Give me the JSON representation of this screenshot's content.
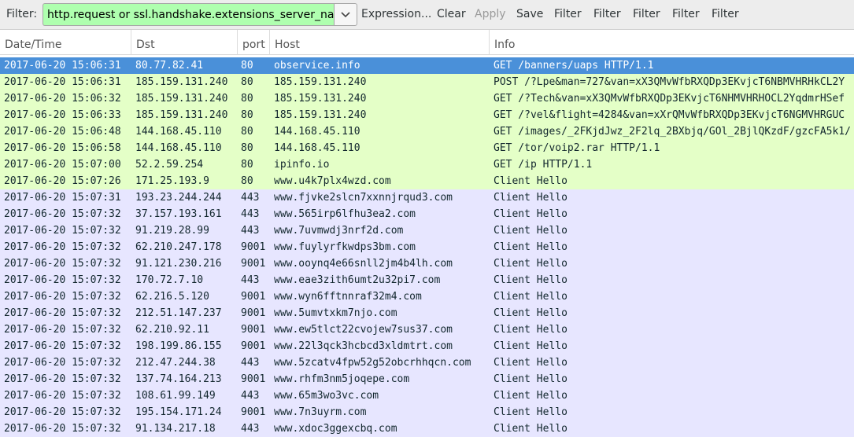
{
  "toolbar": {
    "filter_label": "Filter:",
    "filter_value": "http.request or ssl.handshake.extensions_server_name",
    "dropdown_icon": "chevron-down-icon",
    "buttons": [
      "Expression...",
      "Clear",
      "Apply",
      "Save",
      "Filter",
      "Filter",
      "Filter",
      "Filter",
      "Filter"
    ],
    "disabled": [
      "Apply"
    ]
  },
  "columns": [
    "Date/Time",
    "Dst",
    "port",
    "Host",
    "Info"
  ],
  "colors": {
    "selected": "#4a90d9",
    "http_row": "#e4ffc7",
    "tls_row": "#e7e6ff",
    "filter_valid": "#afffaf"
  },
  "rows": [
    {
      "date": "2017-06-20 15:06:31",
      "dst": "80.77.82.41",
      "port": "80",
      "host": "observice.info",
      "info": "GET /banners/uaps HTTP/1.1",
      "type": "http",
      "selected": true
    },
    {
      "date": "2017-06-20 15:06:31",
      "dst": "185.159.131.240",
      "port": "80",
      "host": "185.159.131.240",
      "info": "POST /?Lpe&man=727&van=xX3QMvWfbRXQDp3EKvjcT6NBMVHRHkCL2Y",
      "type": "http"
    },
    {
      "date": "2017-06-20 15:06:32",
      "dst": "185.159.131.240",
      "port": "80",
      "host": "185.159.131.240",
      "info": "GET /?Tech&van=xX3QMvWfbRXQDp3EKvjcT6NHMVHRHOCL2YqdmrHSef",
      "type": "http"
    },
    {
      "date": "2017-06-20 15:06:33",
      "dst": "185.159.131.240",
      "port": "80",
      "host": "185.159.131.240",
      "info": "GET /?vel&flight=4284&van=xXrQMvWfbRXQDp3EKvjcT6NGMVHRGUC",
      "type": "http"
    },
    {
      "date": "2017-06-20 15:06:48",
      "dst": "144.168.45.110",
      "port": "80",
      "host": "144.168.45.110",
      "info": "GET /images/_2FKjdJwz_2F2lq_2BXbjq/GOl_2BjlQKzdF/gzcFA5k1/",
      "type": "http"
    },
    {
      "date": "2017-06-20 15:06:58",
      "dst": "144.168.45.110",
      "port": "80",
      "host": "144.168.45.110",
      "info": "GET /tor/voip2.rar HTTP/1.1",
      "type": "http"
    },
    {
      "date": "2017-06-20 15:07:00",
      "dst": "52.2.59.254",
      "port": "80",
      "host": "ipinfo.io",
      "info": "GET /ip HTTP/1.1",
      "type": "http"
    },
    {
      "date": "2017-06-20 15:07:26",
      "dst": "171.25.193.9",
      "port": "80",
      "host": "www.u4k7plx4wzd.com",
      "info": "Client Hello",
      "type": "http"
    },
    {
      "date": "2017-06-20 15:07:31",
      "dst": "193.23.244.244",
      "port": "443",
      "host": "www.fjvke2slcn7xxnnjrqud3.com",
      "info": "Client Hello",
      "type": "tls"
    },
    {
      "date": "2017-06-20 15:07:32",
      "dst": "37.157.193.161",
      "port": "443",
      "host": "www.565irp6lfhu3ea2.com",
      "info": "Client Hello",
      "type": "tls"
    },
    {
      "date": "2017-06-20 15:07:32",
      "dst": "91.219.28.99",
      "port": "443",
      "host": "www.7uvmwdj3nrf2d.com",
      "info": "Client Hello",
      "type": "tls"
    },
    {
      "date": "2017-06-20 15:07:32",
      "dst": "62.210.247.178",
      "port": "9001",
      "host": "www.fuylyrfkwdps3bm.com",
      "info": "Client Hello",
      "type": "tls"
    },
    {
      "date": "2017-06-20 15:07:32",
      "dst": "91.121.230.216",
      "port": "9001",
      "host": "www.ooynq4e66snll2jm4b4lh.com",
      "info": "Client Hello",
      "type": "tls"
    },
    {
      "date": "2017-06-20 15:07:32",
      "dst": "170.72.7.10",
      "port": "443",
      "host": "www.eae3zith6umt2u32pi7.com",
      "info": "Client Hello",
      "type": "tls"
    },
    {
      "date": "2017-06-20 15:07:32",
      "dst": "62.216.5.120",
      "port": "9001",
      "host": "www.wyn6fftnnraf32m4.com",
      "info": "Client Hello",
      "type": "tls"
    },
    {
      "date": "2017-06-20 15:07:32",
      "dst": "212.51.147.237",
      "port": "9001",
      "host": "www.5umvtxkm7njo.com",
      "info": "Client Hello",
      "type": "tls"
    },
    {
      "date": "2017-06-20 15:07:32",
      "dst": "62.210.92.11",
      "port": "9001",
      "host": "www.ew5tlct22cvojew7sus37.com",
      "info": "Client Hello",
      "type": "tls"
    },
    {
      "date": "2017-06-20 15:07:32",
      "dst": "198.199.86.155",
      "port": "9001",
      "host": "www.22l3qck3hcbcd3xldmtrt.com",
      "info": "Client Hello",
      "type": "tls"
    },
    {
      "date": "2017-06-20 15:07:32",
      "dst": "212.47.244.38",
      "port": "443",
      "host": "www.5zcatv4fpw52g52obcrhhqcn.com",
      "info": "Client Hello",
      "type": "tls"
    },
    {
      "date": "2017-06-20 15:07:32",
      "dst": "137.74.164.213",
      "port": "9001",
      "host": "www.rhfm3nm5joqepe.com",
      "info": "Client Hello",
      "type": "tls"
    },
    {
      "date": "2017-06-20 15:07:32",
      "dst": "108.61.99.149",
      "port": "443",
      "host": "www.65m3wo3vc.com",
      "info": "Client Hello",
      "type": "tls"
    },
    {
      "date": "2017-06-20 15:07:32",
      "dst": "195.154.171.24",
      "port": "9001",
      "host": "www.7n3uyrm.com",
      "info": "Client Hello",
      "type": "tls"
    },
    {
      "date": "2017-06-20 15:07:32",
      "dst": "91.134.217.18",
      "port": "443",
      "host": "www.xdoc3ggexcbq.com",
      "info": "Client Hello",
      "type": "tls"
    }
  ]
}
